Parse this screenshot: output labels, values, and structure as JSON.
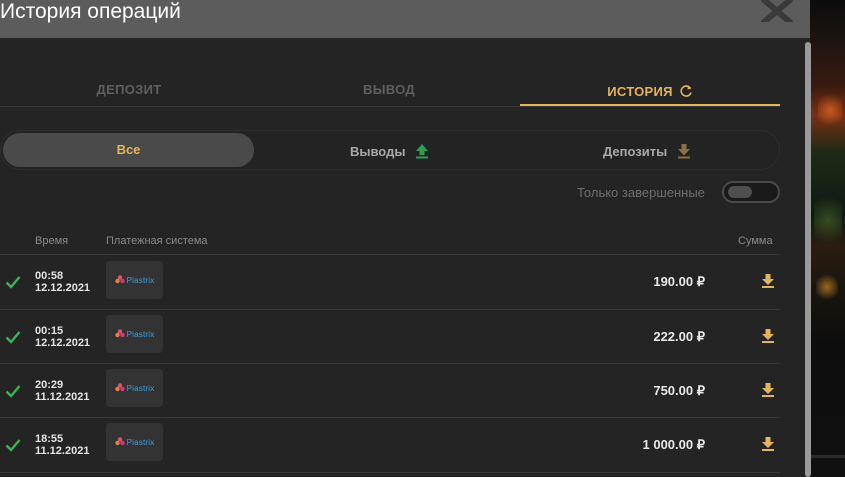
{
  "modal": {
    "title": "История операций"
  },
  "tabs": [
    {
      "label": "ДЕПОЗИТ",
      "active": false
    },
    {
      "label": "ВЫВОД",
      "active": false
    },
    {
      "label": "ИСТОРИЯ",
      "active": true,
      "icon": "refresh-icon"
    }
  ],
  "filters": {
    "all": "Все",
    "withdrawals": "Выводы",
    "deposits": "Депозиты"
  },
  "toggle": {
    "label": "Только завершенные",
    "on": false
  },
  "table": {
    "headers": {
      "time": "Время",
      "payment_system": "Платежная система",
      "amount": "Сумма"
    },
    "rows": [
      {
        "time": "00:58",
        "date": "12.12.2021",
        "payment": "Piastrix",
        "amount": "190.00 ₽",
        "status": "completed",
        "type": "deposit"
      },
      {
        "time": "00:15",
        "date": "12.12.2021",
        "payment": "Piastrix",
        "amount": "222.00 ₽",
        "status": "completed",
        "type": "deposit"
      },
      {
        "time": "20:29",
        "date": "11.12.2021",
        "payment": "Piastrix",
        "amount": "750.00 ₽",
        "status": "completed",
        "type": "deposit"
      },
      {
        "time": "18:55",
        "date": "11.12.2021",
        "payment": "Piastrix",
        "amount": "1 000.00 ₽",
        "status": "completed",
        "type": "deposit"
      }
    ]
  },
  "colors": {
    "accent": "#e2b45c",
    "success": "#3bb35a",
    "withdraw_icon": "#2f9e55",
    "header_bg": "#5c5c5c",
    "body_bg": "#242424"
  }
}
